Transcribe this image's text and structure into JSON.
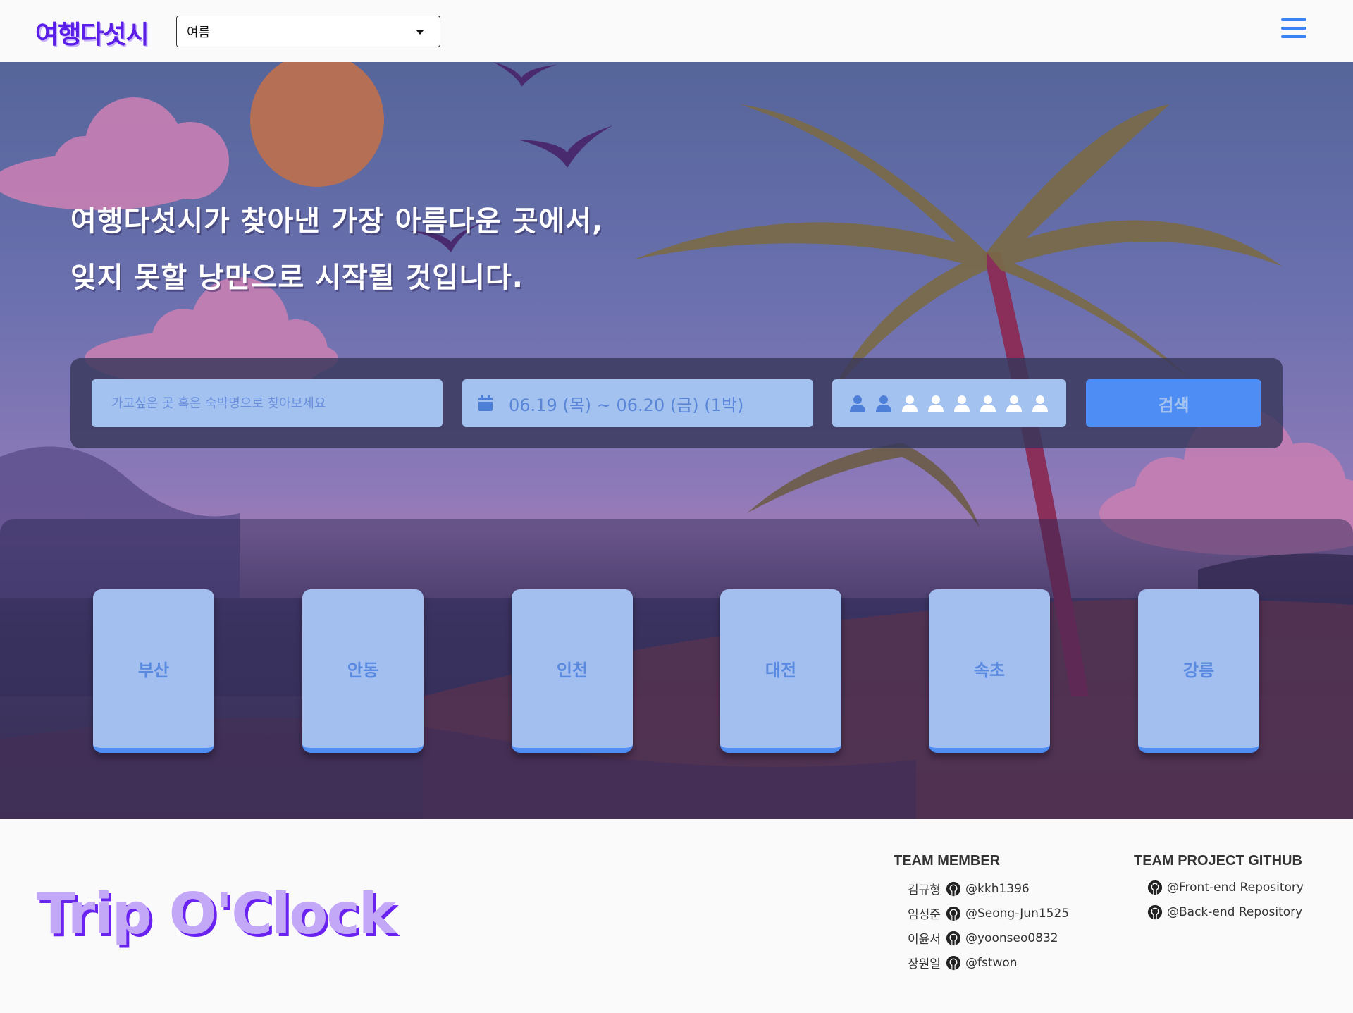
{
  "header": {
    "logo": "여행다섯시",
    "season_selected": "여름",
    "menu_icon": "hamburger-menu-icon"
  },
  "hero": {
    "headline_line1": "여행다섯시가 찾아낸 가장 아름다운 곳에서,",
    "headline_line2": "잊지 못할 낭만으로 시작될 것입니다."
  },
  "search": {
    "placeholder": "가고싶은 곳 혹은 숙박명으로 찾아보세요",
    "date_range": "06.19 (목) ~ 06.20 (금) (1박)",
    "date_icon": "calendar-icon",
    "guests_selected": 2,
    "guests_max": 8,
    "guest_icon": "person-icon",
    "button_label": "검색"
  },
  "cities": [
    "부산",
    "안동",
    "인천",
    "대전",
    "속초",
    "강릉"
  ],
  "footer": {
    "brand": "Trip O'Clock",
    "team_title": "TEAM MEMBER",
    "members": [
      {
        "name": "김규형",
        "github": "@kkh1396"
      },
      {
        "name": "임성준",
        "github": "@Seong-Jun1525"
      },
      {
        "name": "이윤서",
        "github": "@yoonseo0832"
      },
      {
        "name": "장원일",
        "github": "@fstwon"
      }
    ],
    "repo_title": "TEAM PROJECT GITHUB",
    "repos": [
      "@Front-end Repository",
      "@Back-end Repository"
    ],
    "github_icon": "github-icon"
  },
  "colors": {
    "accent": "#4e8df4",
    "field_bg": "#a3c2f0",
    "logo": "#5b1ee8",
    "brand_shadow": "#6a22f0"
  }
}
